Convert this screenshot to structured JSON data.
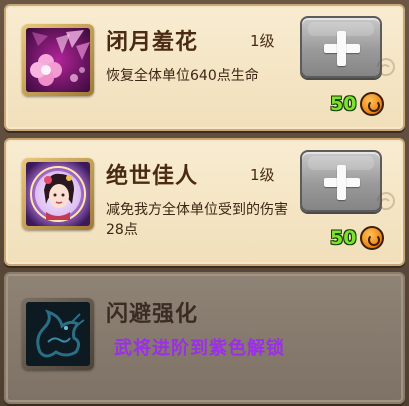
{
  "skills": [
    {
      "name": "闭月羞花",
      "level": "1级",
      "description": "恢复全体单位640点生命",
      "cost": "50",
      "locked": false
    },
    {
      "name": "绝世佳人",
      "level": "1级",
      "description": "减免我方全体单位受到的伤害28点",
      "cost": "50",
      "locked": false
    },
    {
      "name": "闪避强化",
      "unlock_hint": "武将进阶到紫色解锁",
      "locked": true
    }
  ],
  "colors": {
    "card_bg": "#f4e4c2",
    "locked_bg": "#877b6e",
    "name_text": "#4a2b12",
    "cost_text": "#7be32c",
    "unlock_text": "#9b2fe6",
    "button_gray": "#9a9a9a"
  },
  "icons": {
    "skill_1": "pink-flower-petals-icon",
    "skill_2": "beauty-portrait-icon",
    "skill_3": "blue-dragon-icon",
    "cost": "coin-icon",
    "upgrade": "plus-icon"
  }
}
